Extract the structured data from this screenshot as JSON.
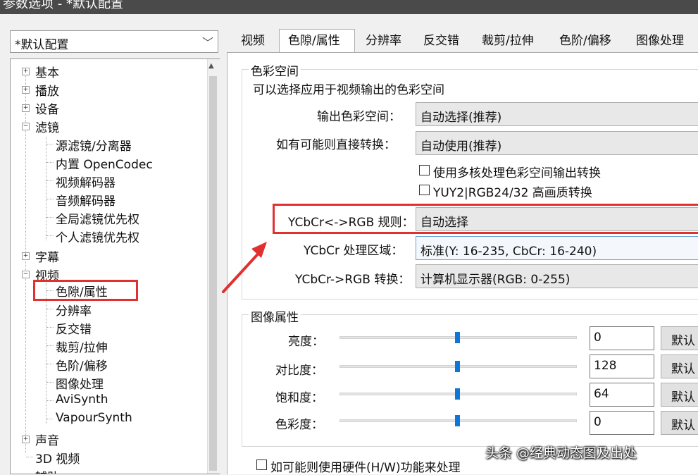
{
  "window": {
    "title": "参数选项 - *默认配置"
  },
  "profile": {
    "selected": "*默认配置"
  },
  "tree": [
    {
      "label": "基本",
      "expander": "+"
    },
    {
      "label": "播放",
      "expander": "+"
    },
    {
      "label": "设备",
      "expander": "+"
    },
    {
      "label": "滤镜",
      "expander": "−"
    },
    {
      "label": "源滤镜/分离器"
    },
    {
      "label": "内置 OpenCodec"
    },
    {
      "label": "视频解码器"
    },
    {
      "label": "音频解码器"
    },
    {
      "label": "全局滤镜优先权"
    },
    {
      "label": "个人滤镜优先权"
    },
    {
      "label": "字幕",
      "expander": "+"
    },
    {
      "label": "视频",
      "expander": "−"
    },
    {
      "label": "色隙/属性",
      "selected": true
    },
    {
      "label": "分辨率"
    },
    {
      "label": "反交错"
    },
    {
      "label": "裁剪/拉伸"
    },
    {
      "label": "色阶/偏移"
    },
    {
      "label": "图像处理"
    },
    {
      "label": "AviSynth"
    },
    {
      "label": "VapourSynth"
    },
    {
      "label": "声音",
      "expander": "+"
    },
    {
      "label": "3D 视频"
    },
    {
      "label": "辅助"
    }
  ],
  "tabs": [
    "视频",
    "色隙/属性",
    "分辨率",
    "反交错",
    "裁剪/拉伸",
    "色阶/偏移",
    "图像处理"
  ],
  "colorspace": {
    "title": "色彩空间",
    "description": "可以选择应用于视频输出的色彩空间",
    "output_label": "输出色彩空间：",
    "output_value": "自动选择(推荐)",
    "direct_label": "如有可能则直接转换：",
    "direct_value": "自动使用(推荐)",
    "multicore_label": "使用多核处理色彩空间输出转换",
    "yuy2_label": "YUY2|RGB24/32 高画质转换",
    "rule_label": "YCbCr<->RGB 规则：",
    "rule_value": "自动选择",
    "range_label": "YCbCr 处理区域：",
    "range_value": "标准(Y: 16-235, CbCr: 16-240)",
    "convert_label": "YCbCr->RGB 转换：",
    "convert_value": "计算机显示器(RGB: 0-255)"
  },
  "image_props": {
    "title": "图像属性",
    "reset_label": "默认",
    "rows": [
      {
        "label": "亮度：",
        "value": "0"
      },
      {
        "label": "对比度：",
        "value": "128"
      },
      {
        "label": "饱和度：",
        "value": "64"
      },
      {
        "label": "色彩度：",
        "value": "0"
      }
    ]
  },
  "hardware": {
    "label": "如可能则使用硬件(H/W)功能来处理"
  },
  "watermark": "头条 @经典动态图及出处",
  "colors": {
    "highlight": "#e03030",
    "slider": "#0c77d6"
  }
}
